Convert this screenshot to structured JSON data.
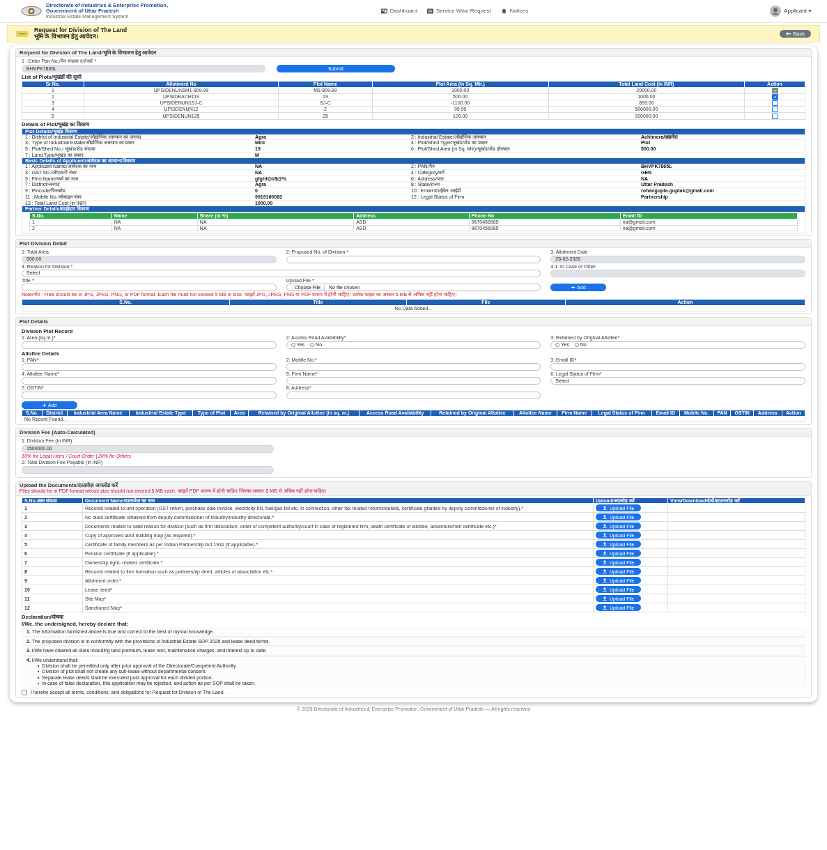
{
  "header": {
    "brand": [
      "Directorate of Industries & Enterprise Promotion,",
      "Government of Uttar Pradesh",
      "Industrial Estate Management System"
    ],
    "nav": [
      {
        "label": "Dashboard",
        "selected": false
      },
      {
        "label": "Service Wise Request",
        "selected": false
      },
      {
        "label": "Notices",
        "selected": false
      }
    ],
    "user": "Applicant"
  },
  "banner": {
    "title": "Request for Division of The Land",
    "title_hi": "भूमि के विभाजन हेतु आवेदन।",
    "back": "Back"
  },
  "request": {
    "heading": "Request for Division of The Land/भूमि के विभाजन हेतु आवेदन",
    "pan_label": "1 : Enter Pan No./पैन संख्या दर्ज करें *",
    "pan_value": "BHVPK7865L",
    "submit": "Submit",
    "list_title": "List of Plots/भूखंडों की सूची",
    "columns": [
      "Sr.No.",
      "Allotment No",
      "Plot Name",
      "Plot Area (in Sq. Mtr.)",
      "Total Land Cost (in INR)",
      "Action"
    ],
    "rows": [
      {
        "cells": [
          "1",
          "UPSIDENUN1M1-809.99",
          "M1-809.99",
          "1000.00",
          "20000.00"
        ],
        "selected": true,
        "disabled": true
      },
      {
        "cells": [
          "2",
          "UPSIDEACH119",
          "19",
          "500.00",
          "1000.00"
        ],
        "selected": true,
        "disabled": false
      },
      {
        "cells": [
          "3",
          "UPSIDENUN1SJ-C",
          "SJ-C",
          "-1100.00",
          "899.00"
        ],
        "selected": false,
        "disabled": false
      },
      {
        "cells": [
          "4",
          "UPSIDENUN12",
          "2",
          "99.99",
          "500000.00"
        ],
        "selected": false,
        "disabled": false
      },
      {
        "cells": [
          "5",
          "UPSIDENUN125",
          "25",
          "100.00",
          "200000.00"
        ],
        "selected": false,
        "disabled": false
      }
    ]
  },
  "details": {
    "heading": "Details of Plot/भूखंड का विवरण",
    "groups": [
      {
        "title": "Plot Details/भूखंड विवरण",
        "pairs": [
          [
            "1 : District of Industrial Estate/औद्योगिक आस्थान का जनपद",
            "Agra",
            "2 : Industrial Estate/औद्योगिक आस्थान",
            "Achhnera/अछनेरा"
          ],
          [
            "3 : Type of Industrial Estate/औद्योगिक आस्थान का प्रकार",
            "Mini",
            "4 : Plot/Shed Type/भूखंड/शेड का प्रकार",
            "Plot"
          ],
          [
            "5 : Plot/Shed No./ भूखंड/शेड संख्या",
            "19",
            "6 : Plot/Shed Area (in Sq. Mtr)/भूखंड/शेड क्षेत्रफल",
            "500.00"
          ],
          [
            "7 : Land Type/भूखंड का प्रकार",
            "M"
          ]
        ]
      },
      {
        "title": "Basic Details of Applicant/आवेदक का सामान्य विवरण",
        "pairs": [
          [
            "1 : Applicant Name/आवेदक का नाम",
            "NA",
            "2 : PAN/पैन",
            "BHVPK7865L"
          ],
          [
            "3 : GST No./जीएसटी नंबर",
            "NA",
            "4 : Category/वर्ग",
            "GEN"
          ],
          [
            "5 : Firm Name/फर्म का नाम",
            "gfghf@#$@%",
            "6 : Address/पता",
            "NA"
          ],
          [
            "7 : District/जनपद",
            "Agra",
            "8 : State/राज्य",
            "Uttar Pradesh"
          ],
          [
            "9 : Pincode/पिनकोड",
            "0",
            "10 : Email ID/ईमेल आईडी",
            "rohangupta.guptak@gmail.com"
          ],
          [
            "11 : Mobile No./मोबाइल नंबर",
            "9919160083",
            "12 : Legal Status of Firm",
            "Partnership"
          ],
          [
            "13 : Total Land Cost (in INR)",
            "1000.00"
          ]
        ]
      }
    ],
    "partner_title": "Partner Details/साझेदार विवरण",
    "partner_columns": [
      "S.No.",
      "Name",
      "Share (in %)",
      "Address",
      "Phone No",
      "Email ID"
    ],
    "partner_rows": [
      [
        "1",
        "NA",
        "NA",
        "ASD",
        "9670456985",
        "na@gmail.com"
      ],
      [
        "2",
        "NA",
        "NA",
        "ASD",
        "9670456985",
        "na@gmail.com"
      ]
    ]
  },
  "division": {
    "heading": "Plot Division Detail",
    "fields": [
      {
        "kind": "input",
        "label": "1: Total Area",
        "value": "500.00",
        "disabled": true,
        "wide": false
      },
      {
        "kind": "input",
        "label": "2: Proposed No. of Division *",
        "disabled": false,
        "wide": false
      },
      {
        "kind": "input",
        "label": "3: Allotment Date",
        "value": "25-02-2026",
        "disabled": true,
        "wide": false
      },
      {
        "kind": "select",
        "label": "4: Reason for Division *",
        "value": "Select",
        "disabled": false,
        "wide": true
      },
      {
        "kind": "input",
        "label": "4.1: In Case of Other",
        "disabled": true,
        "wide": false
      },
      {
        "kind": "input",
        "label": "Title *",
        "disabled": false,
        "wide": false
      },
      {
        "kind": "file",
        "label": "Upload File *",
        "button": "Choose File",
        "value": "No file chosen",
        "disabled": false,
        "wide": false
      },
      {
        "kind": "button",
        "label": "Add",
        "disabled": false,
        "wide": false
      }
    ],
    "note": "Note/नोट : Files should be in JPG, JPEG, PNG, or PDF format. Each file must not exceed 5 MB in size. फाइलें JPG, JPEG, PNG या PDF प्रारूप में होनी चाहिए। प्रत्येक फाइल का आकार 5 MB से अधिक नहीं होना चाहिए।",
    "columns": [
      "S.No.",
      "Title",
      "File",
      "Action"
    ],
    "empty": "No Data Added..."
  },
  "plot_details": {
    "heading": "Plot Details",
    "sections": [
      {
        "title": "Division Plot Record",
        "fields": [
          {
            "kind": "input",
            "label": "1: Area (sq.m.)*"
          },
          {
            "kind": "radio",
            "label": "2: Access Road Availability*",
            "options": [
              {
                "label": "Yes",
                "selected": false
              },
              {
                "label": "No",
                "selected": false
              }
            ]
          },
          {
            "kind": "radio",
            "label": "3: Retained by Original Allottee*",
            "options": [
              {
                "label": "Yes",
                "selected": false
              },
              {
                "label": "No",
                "selected": false
              }
            ]
          }
        ]
      },
      {
        "title": "Allottee Details",
        "fields": [
          {
            "kind": "input",
            "label": "1: PAN*"
          },
          {
            "kind": "input",
            "label": "2: Mobile No.*"
          },
          {
            "kind": "input",
            "label": "3: Email ID*"
          },
          {
            "kind": "input",
            "label": "4: Allottee Name*"
          },
          {
            "kind": "input",
            "label": "5: Firm Name*"
          },
          {
            "kind": "select",
            "label": "6: Legal Status of Firm*",
            "value": "Select"
          },
          {
            "kind": "input",
            "label": "7: GSTIN*"
          },
          {
            "kind": "input",
            "label": "8: Address*"
          }
        ]
      }
    ],
    "add": "Add",
    "columns": [
      "S.No.",
      "District",
      "Industrial Area Name",
      "Industrial Estate Type",
      "Type of Plot",
      "Area",
      "Retained by Original Allottee (in sq. m.)",
      "Access Road Availability",
      "Retained by Original Allottee",
      "Allottee Name",
      "Firm Name",
      "Legal Status of Firm",
      "Email ID",
      "Mobile No.",
      "PAN",
      "GSTIN",
      "Address",
      "Action"
    ],
    "empty": "No Record Found.."
  },
  "fee": {
    "heading": "Division Fee (Auto-Calculated)",
    "fee_label": "1: Division Fee (in INR)",
    "fee_value": "1500000.00",
    "fee_note": "10% for Legal Heirs / Court Order | 20% for Others",
    "total_label": "2: Total Division Fee Payable (in INR)"
  },
  "upload": {
    "heading": "Upload the Documents/दस्तावेज़ अपलोड करें",
    "note": "Files should be in PDF format whose size should not exceed 5 MB each. फाइलें PDF प्रारूप में होनी चाहिए जिनका आकार 5 MB से अधिक नहीं होना चाहिए।",
    "columns": [
      "S.No./क्रम संख्या",
      "Document Name/दस्तावेज़ का नाम",
      "Upload/अपलोड करें",
      "View/Download/देखें/डाउनलोड करें"
    ],
    "docs": [
      {
        "no": "1",
        "button": "Upload File",
        "name": "Records related to unit operation (GST return, purchase sale invoice, electricity bill, fuel/gas bill etc. in connection, other tax related returns/details, certificate granted by deputy commissioner of industry).*"
      },
      {
        "no": "2",
        "button": "Upload File",
        "name": "No dues certificate obtained from deputy commissioner of industry/industry directorate.*"
      },
      {
        "no": "3",
        "button": "Upload File",
        "name": "Documents related to valid reason for division (such as firm dissolution, order of competent authority/court in case of registered firm, death certificate of allottee, adventure/heir certificate etc.)*"
      },
      {
        "no": "4",
        "button": "Upload File",
        "name": "Copy of approved land building map (as required).*"
      },
      {
        "no": "5",
        "button": "Upload File",
        "name": "Certificate of family members as per Indian Partnership Act 1932 (if applicable).*"
      },
      {
        "no": "6",
        "button": "Upload File",
        "name": "Pension certificate (if applicable).*"
      },
      {
        "no": "7",
        "button": "Upload File",
        "name": "Ownership right- related certificate.*"
      },
      {
        "no": "8",
        "button": "Upload File",
        "name": "Records related to firm formation such as partnership deed, articles of association etc.*"
      },
      {
        "no": "9",
        "button": "Upload File",
        "name": "Allotment order.*"
      },
      {
        "no": "10",
        "button": "Upload File",
        "name": "Lease deed*"
      },
      {
        "no": "11",
        "button": "Upload File",
        "name": "Site Map*"
      },
      {
        "no": "12",
        "button": "Upload File",
        "name": "Sanctioned Map*"
      }
    ]
  },
  "declaration": {
    "heading": "Declaration/घोषणा",
    "intro": "I/We, the undersigned, hereby declare that:",
    "items": [
      {
        "num": "1.",
        "text": "The information furnished above is true and correct to the best of my/our knowledge."
      },
      {
        "num": "2.",
        "text": "The proposed division is in conformity with the provisions of Industrial Estate SOP 2025 and lease deed terms."
      },
      {
        "num": "3.",
        "text": "I/We have cleared all dues including land premium, lease rent, maintenance charges, and interest up to date."
      },
      {
        "num": "4.",
        "text": "I/We understand that:",
        "bullets": [
          {
            "marker": "•",
            "text": "Division shall be permitted only after prior approval of the Directorate/Competent Authority."
          },
          {
            "marker": "•",
            "text": "Division of plot shall not create any sub-lease without departmental consent."
          },
          {
            "marker": "•",
            "text": "Separate lease deeds shall be executed post approval for each divided portion."
          },
          {
            "marker": "•",
            "text": "In case of false declaration, this application may be rejected, and action as per SOP shall be taken."
          }
        ]
      }
    ],
    "accept": {
      "label": "I hereby accept all terms, conditions, and obligations for Request for Division of The Land.",
      "checked": false
    }
  },
  "footer": "© 2025 Directorate of Industries & Enterprise Promotion, Government of Uttar Pradesh — All rights reserved"
}
